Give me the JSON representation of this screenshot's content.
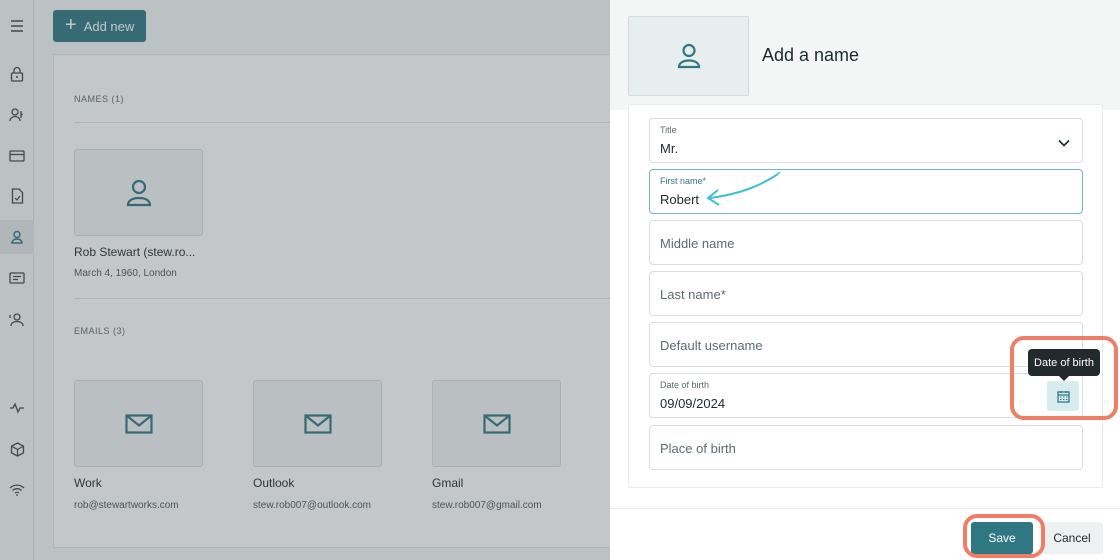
{
  "toolbar": {
    "add_new_label": "Add new"
  },
  "sidebar": {
    "icons": [
      "menu-icon",
      "lock-icon",
      "users-icon",
      "card-icon",
      "document-icon",
      "person-icon",
      "id-card-icon",
      "contacts-icon",
      "activity-icon",
      "cube-icon",
      "wifi-icon"
    ],
    "active": "person-icon"
  },
  "names_section": {
    "label": "NAMES (1)",
    "items": [
      {
        "title": "Rob Stewart (stew.ro...",
        "subtitle": "March 4, 1960, London"
      }
    ]
  },
  "emails_section": {
    "label": "EMAILS (3)",
    "items": [
      {
        "title": "Work",
        "subtitle": "rob@stewartworks.com"
      },
      {
        "title": "Outlook",
        "subtitle": "stew.rob007@outlook.com"
      },
      {
        "title": "Gmail",
        "subtitle": "stew.rob007@gmail.com"
      }
    ]
  },
  "drawer": {
    "title": "Add a name",
    "fields": {
      "title": {
        "label": "Title",
        "value": "Mr."
      },
      "first_name": {
        "label": "First name*",
        "value": "Robert"
      },
      "middle_name": {
        "placeholder": "Middle name"
      },
      "last_name": {
        "placeholder": "Last name*"
      },
      "default_username": {
        "placeholder": "Default username"
      },
      "date_of_birth": {
        "label": "Date of birth",
        "value": "09/09/2024"
      },
      "place_of_birth": {
        "placeholder": "Place of birth"
      }
    },
    "tooltip": "Date of birth",
    "save_label": "Save",
    "cancel_label": "Cancel"
  },
  "colors": {
    "accent": "#2f7883",
    "highlight": "#f07e66",
    "annotation_arrow": "#3fc1d0"
  }
}
